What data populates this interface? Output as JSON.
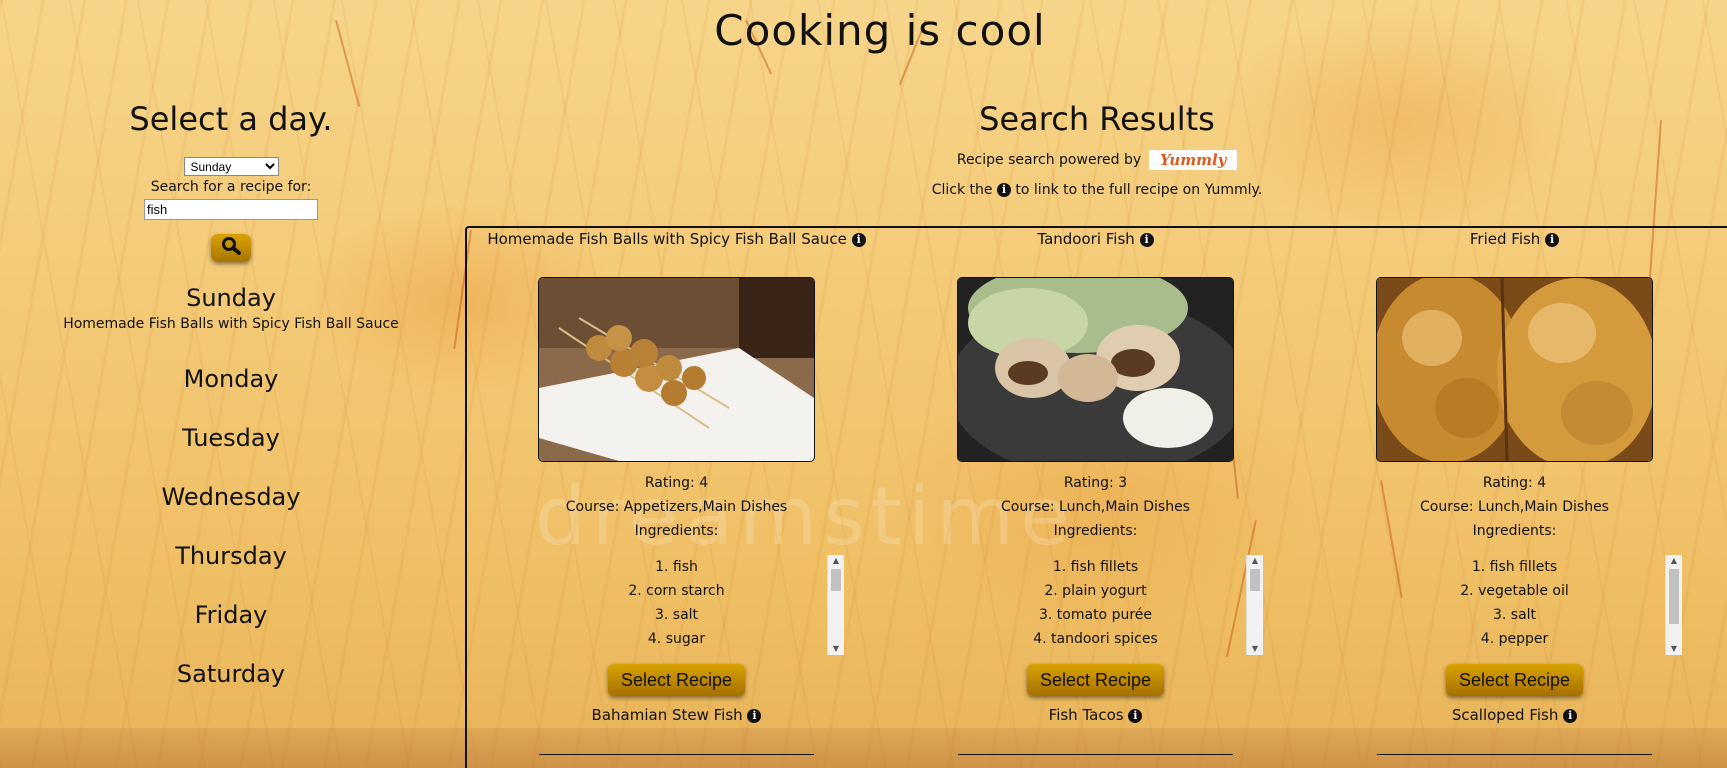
{
  "site_title": "Cooking is cool",
  "sidebar": {
    "heading": "Select a day.",
    "selected_day": "Sunday",
    "search_label": "Search for a recipe for:",
    "search_value": "fish",
    "search_icon": "search-icon",
    "days": [
      {
        "name": "Sunday",
        "recipe": "Homemade Fish Balls with Spicy Fish Ball Sauce"
      },
      {
        "name": "Monday",
        "recipe": ""
      },
      {
        "name": "Tuesday",
        "recipe": ""
      },
      {
        "name": "Wednesday",
        "recipe": ""
      },
      {
        "name": "Thursday",
        "recipe": ""
      },
      {
        "name": "Friday",
        "recipe": ""
      },
      {
        "name": "Saturday",
        "recipe": ""
      }
    ]
  },
  "results": {
    "heading": "Search Results",
    "powered_by": "Recipe search powered by",
    "logo_text": "Yummly",
    "click_note_before": "Click the",
    "click_note_after": "to link to the full recipe on Yummly.",
    "select_label": "Select Recipe",
    "cards": [
      {
        "title": "Homemade Fish Balls with Spicy Fish Ball Sauce",
        "rating": "Rating: 4",
        "course": "Course: Appetizers,Main Dishes",
        "ingredients_label": "Ingredients:",
        "ingredients": [
          "1. fish",
          "2. corn starch",
          "3. salt",
          "4. sugar"
        ],
        "image": "fish-balls-skewers"
      },
      {
        "title": "Tandoori Fish",
        "rating": "Rating: 3",
        "course": "Course: Lunch,Main Dishes",
        "ingredients_label": "Ingredients:",
        "ingredients": [
          "1. fish fillets",
          "2. plain yogurt",
          "3. tomato purée",
          "4. tandoori spices"
        ],
        "image": "tandoori-fish-plate"
      },
      {
        "title": "Fried Fish",
        "rating": "Rating: 4",
        "course": "Course: Lunch,Main Dishes",
        "ingredients_label": "Ingredients:",
        "ingredients": [
          "1. fish fillets",
          "2. vegetable oil",
          "3. salt",
          "4. pepper"
        ],
        "image": "fried-fish-closeup"
      }
    ],
    "next_row": [
      "Bahamian Stew Fish",
      "Fish Tacos",
      "Scalloped Fish"
    ]
  }
}
